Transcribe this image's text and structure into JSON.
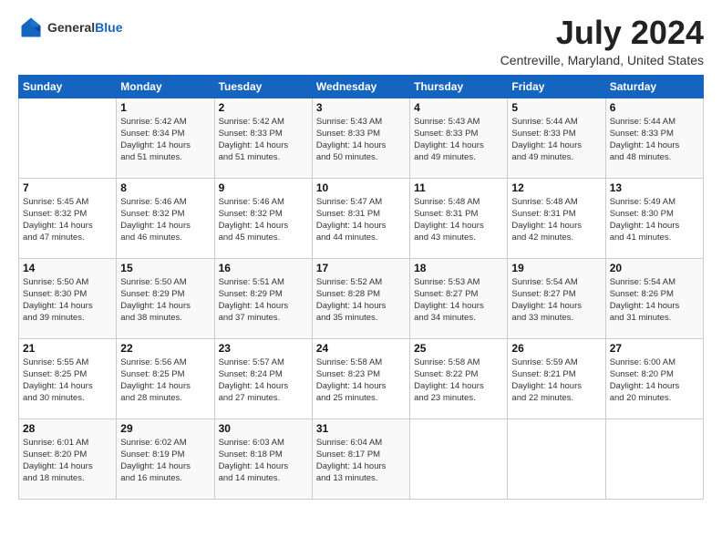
{
  "header": {
    "logo_general": "General",
    "logo_blue": "Blue",
    "month": "July 2024",
    "location": "Centreville, Maryland, United States"
  },
  "weekdays": [
    "Sunday",
    "Monday",
    "Tuesday",
    "Wednesday",
    "Thursday",
    "Friday",
    "Saturday"
  ],
  "weeks": [
    [
      {
        "day": "",
        "info": ""
      },
      {
        "day": "1",
        "info": "Sunrise: 5:42 AM\nSunset: 8:34 PM\nDaylight: 14 hours\nand 51 minutes."
      },
      {
        "day": "2",
        "info": "Sunrise: 5:42 AM\nSunset: 8:33 PM\nDaylight: 14 hours\nand 51 minutes."
      },
      {
        "day": "3",
        "info": "Sunrise: 5:43 AM\nSunset: 8:33 PM\nDaylight: 14 hours\nand 50 minutes."
      },
      {
        "day": "4",
        "info": "Sunrise: 5:43 AM\nSunset: 8:33 PM\nDaylight: 14 hours\nand 49 minutes."
      },
      {
        "day": "5",
        "info": "Sunrise: 5:44 AM\nSunset: 8:33 PM\nDaylight: 14 hours\nand 49 minutes."
      },
      {
        "day": "6",
        "info": "Sunrise: 5:44 AM\nSunset: 8:33 PM\nDaylight: 14 hours\nand 48 minutes."
      }
    ],
    [
      {
        "day": "7",
        "info": "Sunrise: 5:45 AM\nSunset: 8:32 PM\nDaylight: 14 hours\nand 47 minutes."
      },
      {
        "day": "8",
        "info": "Sunrise: 5:46 AM\nSunset: 8:32 PM\nDaylight: 14 hours\nand 46 minutes."
      },
      {
        "day": "9",
        "info": "Sunrise: 5:46 AM\nSunset: 8:32 PM\nDaylight: 14 hours\nand 45 minutes."
      },
      {
        "day": "10",
        "info": "Sunrise: 5:47 AM\nSunset: 8:31 PM\nDaylight: 14 hours\nand 44 minutes."
      },
      {
        "day": "11",
        "info": "Sunrise: 5:48 AM\nSunset: 8:31 PM\nDaylight: 14 hours\nand 43 minutes."
      },
      {
        "day": "12",
        "info": "Sunrise: 5:48 AM\nSunset: 8:31 PM\nDaylight: 14 hours\nand 42 minutes."
      },
      {
        "day": "13",
        "info": "Sunrise: 5:49 AM\nSunset: 8:30 PM\nDaylight: 14 hours\nand 41 minutes."
      }
    ],
    [
      {
        "day": "14",
        "info": "Sunrise: 5:50 AM\nSunset: 8:30 PM\nDaylight: 14 hours\nand 39 minutes."
      },
      {
        "day": "15",
        "info": "Sunrise: 5:50 AM\nSunset: 8:29 PM\nDaylight: 14 hours\nand 38 minutes."
      },
      {
        "day": "16",
        "info": "Sunrise: 5:51 AM\nSunset: 8:29 PM\nDaylight: 14 hours\nand 37 minutes."
      },
      {
        "day": "17",
        "info": "Sunrise: 5:52 AM\nSunset: 8:28 PM\nDaylight: 14 hours\nand 35 minutes."
      },
      {
        "day": "18",
        "info": "Sunrise: 5:53 AM\nSunset: 8:27 PM\nDaylight: 14 hours\nand 34 minutes."
      },
      {
        "day": "19",
        "info": "Sunrise: 5:54 AM\nSunset: 8:27 PM\nDaylight: 14 hours\nand 33 minutes."
      },
      {
        "day": "20",
        "info": "Sunrise: 5:54 AM\nSunset: 8:26 PM\nDaylight: 14 hours\nand 31 minutes."
      }
    ],
    [
      {
        "day": "21",
        "info": "Sunrise: 5:55 AM\nSunset: 8:25 PM\nDaylight: 14 hours\nand 30 minutes."
      },
      {
        "day": "22",
        "info": "Sunrise: 5:56 AM\nSunset: 8:25 PM\nDaylight: 14 hours\nand 28 minutes."
      },
      {
        "day": "23",
        "info": "Sunrise: 5:57 AM\nSunset: 8:24 PM\nDaylight: 14 hours\nand 27 minutes."
      },
      {
        "day": "24",
        "info": "Sunrise: 5:58 AM\nSunset: 8:23 PM\nDaylight: 14 hours\nand 25 minutes."
      },
      {
        "day": "25",
        "info": "Sunrise: 5:58 AM\nSunset: 8:22 PM\nDaylight: 14 hours\nand 23 minutes."
      },
      {
        "day": "26",
        "info": "Sunrise: 5:59 AM\nSunset: 8:21 PM\nDaylight: 14 hours\nand 22 minutes."
      },
      {
        "day": "27",
        "info": "Sunrise: 6:00 AM\nSunset: 8:20 PM\nDaylight: 14 hours\nand 20 minutes."
      }
    ],
    [
      {
        "day": "28",
        "info": "Sunrise: 6:01 AM\nSunset: 8:20 PM\nDaylight: 14 hours\nand 18 minutes."
      },
      {
        "day": "29",
        "info": "Sunrise: 6:02 AM\nSunset: 8:19 PM\nDaylight: 14 hours\nand 16 minutes."
      },
      {
        "day": "30",
        "info": "Sunrise: 6:03 AM\nSunset: 8:18 PM\nDaylight: 14 hours\nand 14 minutes."
      },
      {
        "day": "31",
        "info": "Sunrise: 6:04 AM\nSunset: 8:17 PM\nDaylight: 14 hours\nand 13 minutes."
      },
      {
        "day": "",
        "info": ""
      },
      {
        "day": "",
        "info": ""
      },
      {
        "day": "",
        "info": ""
      }
    ]
  ]
}
